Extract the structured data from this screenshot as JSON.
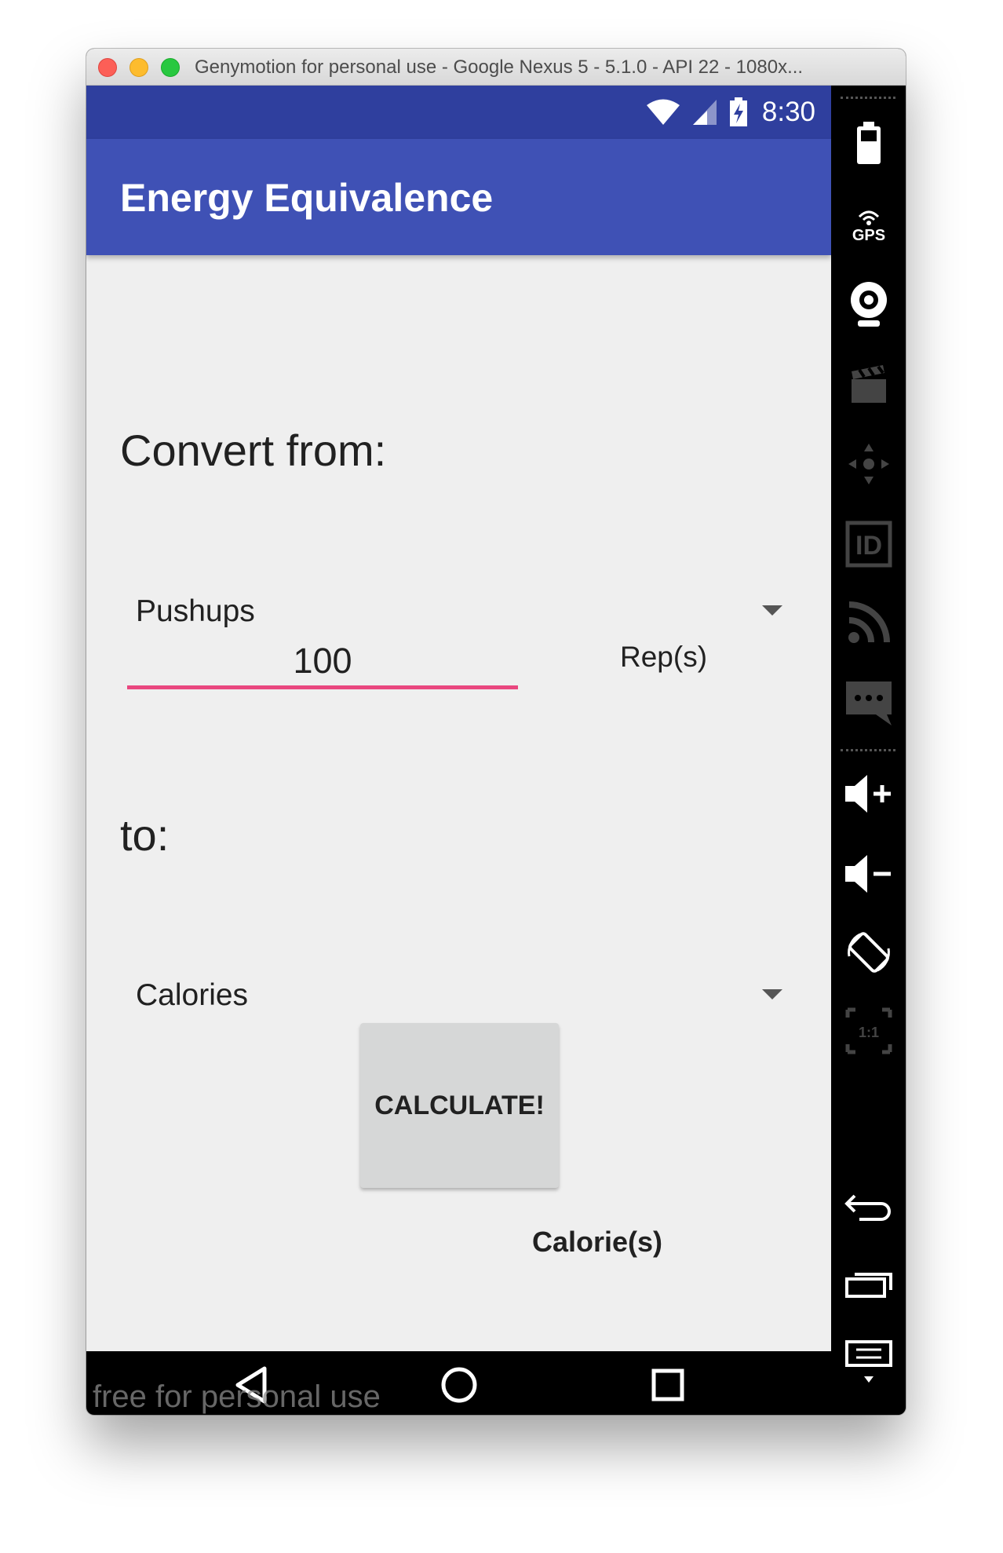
{
  "window": {
    "title": "Genymotion for personal use - Google Nexus 5 - 5.1.0 - API 22 - 1080x..."
  },
  "statusbar": {
    "time": "8:30"
  },
  "app": {
    "title": "Energy Equivalence",
    "convert_from_label": "Convert from:",
    "from_spinner_value": "Pushups",
    "amount_value": "100",
    "from_unit": "Rep(s)",
    "to_label": "to:",
    "to_spinner_value": "Calories",
    "calculate_label": "CALCULATE!",
    "result_unit": "Calorie(s)"
  },
  "watermark": "free for personal use",
  "sidebar": {
    "gps_label": "GPS",
    "id_label": "ID",
    "ratio_label": "1:1"
  },
  "colors": {
    "statusbar": "#2f3f9e",
    "appbar": "#3f51b5",
    "accent": "#e9477f",
    "background": "#efefef"
  }
}
